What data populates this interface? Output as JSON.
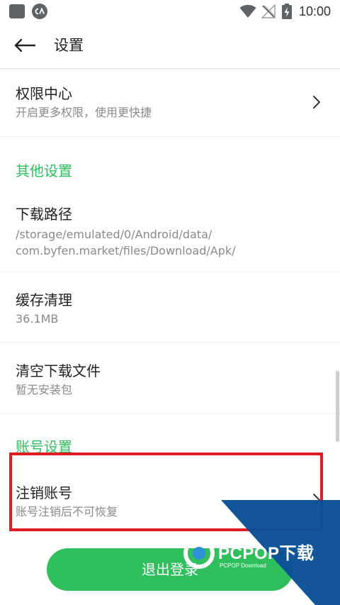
{
  "status_bar": {
    "time": "10:00",
    "icons": [
      "app-square-icon",
      "app-ca-icon",
      "wifi-icon",
      "no-signal-icon",
      "battery-charging-icon"
    ]
  },
  "app_bar": {
    "back_icon": "arrow-left-icon",
    "title": "设置"
  },
  "items": {
    "permission": {
      "title": "权限中心",
      "subtitle": "开启更多权限，使用更快捷"
    },
    "other_section": "其他设置",
    "download_path": {
      "title": "下载路径",
      "line1": "/storage/emulated/0/Android/data/",
      "line2": "com.byfen.market/files/Download/Apk/"
    },
    "cache": {
      "title": "缓存清理",
      "subtitle": "36.1MB"
    },
    "clear_downloads": {
      "title": "清空下载文件",
      "subtitle": "暂无安装包"
    },
    "account_section": "账号设置",
    "cancel_account": {
      "title": "注销账号",
      "subtitle": "账号注销后不可恢复"
    }
  },
  "logout_button": {
    "label": "退出登录"
  },
  "watermark": {
    "brand": "PCPOP下载",
    "sub": "PCPOP Download"
  },
  "colors": {
    "accent_green": "#2fbf5c",
    "highlight_red": "#e11b22",
    "watermark_blue": "#0b4f96"
  }
}
